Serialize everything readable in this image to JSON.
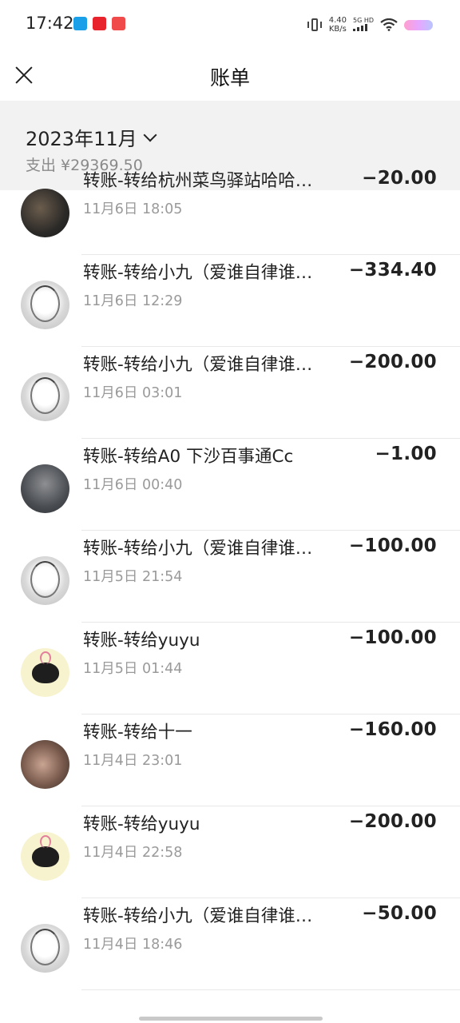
{
  "status_bar": {
    "time": "17:42",
    "net_speed_value": "4.40",
    "net_speed_unit": "KB/s",
    "signal_label": "5G HD"
  },
  "header": {
    "title": "账单"
  },
  "summary": {
    "month": "2023年11月",
    "expense": "支出 ¥29369.50"
  },
  "transactions": [
    {
      "name": "转账-转给杭州菜鸟驿站哈哈…",
      "date": "11月6日 18:05",
      "amount": "−20.00",
      "avatar": "dark-photo"
    },
    {
      "name": "转账-转给小九（爱谁自律谁…",
      "date": "11月6日 12:29",
      "amount": "−334.40",
      "avatar": "anime-girl-sketch"
    },
    {
      "name": "转账-转给小九（爱谁自律谁…",
      "date": "11月6日 03:01",
      "amount": "−200.00",
      "avatar": "anime-girl-sketch"
    },
    {
      "name": "转账-转给A0 下沙百事通Cc",
      "date": "11月6日 00:40",
      "amount": "−1.00",
      "avatar": "man-photo"
    },
    {
      "name": "转账-转给小九（爱谁自律谁…",
      "date": "11月5日 21:54",
      "amount": "−100.00",
      "avatar": "anime-girl-sketch"
    },
    {
      "name": "转账-转给yuyu",
      "date": "11月5日 01:44",
      "amount": "−100.00",
      "avatar": "chibi-bunny"
    },
    {
      "name": "转账-转给十一",
      "date": "11月4日 23:01",
      "amount": "−160.00",
      "avatar": "room-photo"
    },
    {
      "name": "转账-转给yuyu",
      "date": "11月4日 22:58",
      "amount": "−200.00",
      "avatar": "chibi-bunny"
    },
    {
      "name": "转账-转给小九（爱谁自律谁…",
      "date": "11月4日 18:46",
      "amount": "−50.00",
      "avatar": "anime-girl-sketch"
    }
  ]
}
